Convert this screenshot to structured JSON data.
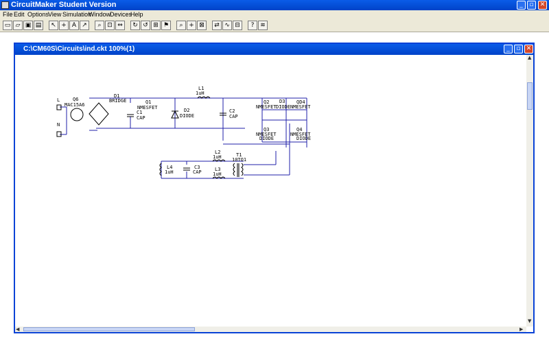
{
  "window": {
    "title": "CircuitMaker Student Version"
  },
  "menu": [
    "File",
    "Edit",
    "Options",
    "View",
    "Simulation",
    "Window",
    "Devices",
    "Help"
  ],
  "document": {
    "title": "C:\\CM60S\\Circuits\\ind.ckt 100%(1)"
  },
  "components": {
    "L": "L",
    "N": "N",
    "Q6_name": "Q6",
    "Q6_part": "MAC15A6",
    "D1_name": "D1",
    "D1_part": "BRIDGE",
    "Q1_name": "Q1",
    "Q1_part": "NMESFET",
    "C1_name": "C1",
    "C1_part": "CAP",
    "D2_name": "D2",
    "D2_part": "DIODE",
    "L1_name": "L1",
    "L1_part": "1uH",
    "C2_name": "C2",
    "C2_part": "CAP",
    "Q2_name": "Q2",
    "Q2_part": "NMESFET",
    "D3_name": "D3",
    "D3_part": "DIODE",
    "Q_topright": "QD4",
    "Q_topright_part": "NMESFET",
    "Q3_name": "Q3",
    "Q3_part": "NMESFET",
    "D_mid_part": "DIODE",
    "Q4_name": "Q4",
    "Q4_part": "NMESFET",
    "D_right_part": "DIODE",
    "L2_name": "L2",
    "L2_part": "1uH",
    "T1_name": "T1",
    "T1_part": "10TO1",
    "L3_name": "L3",
    "L3_part": "1uH",
    "L4_name": "L4",
    "L4_part": "1uH",
    "C3_name": "C3",
    "C3_part": "CAP"
  },
  "colors": {
    "wire": "#1f1fa8",
    "titlebar": "#0a5ce8",
    "close": "#d4482a"
  }
}
